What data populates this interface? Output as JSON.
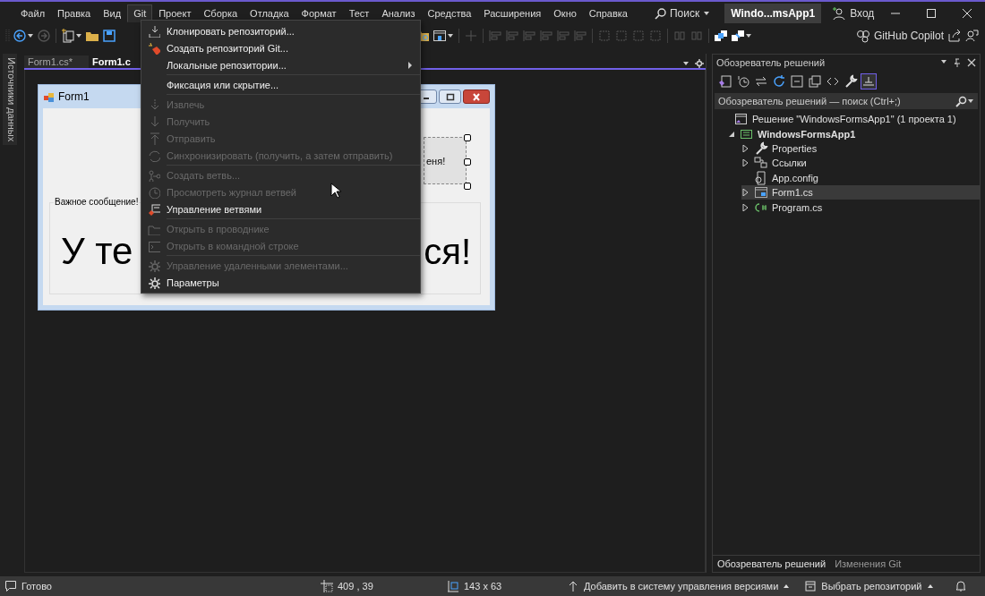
{
  "title_bar": {
    "menu": [
      {
        "label": "Файл",
        "selected": false
      },
      {
        "label": "Правка",
        "selected": false
      },
      {
        "label": "Вид",
        "selected": false
      },
      {
        "label": "Git",
        "selected": true
      },
      {
        "label": "Проект",
        "selected": false
      },
      {
        "label": "Сборка",
        "selected": false
      },
      {
        "label": "Отладка",
        "selected": false
      },
      {
        "label": "Формат",
        "selected": false
      },
      {
        "label": "Тест",
        "selected": false
      },
      {
        "label": "Анализ",
        "selected": false
      },
      {
        "label": "Средства",
        "selected": false
      },
      {
        "label": "Расширения",
        "selected": false
      },
      {
        "label": "Окно",
        "selected": false
      },
      {
        "label": "Справка",
        "selected": false
      }
    ],
    "search": "Поиск",
    "solution_name": "Windo...msApp1",
    "sign_in": "Вход"
  },
  "toolbar": {
    "copilot": "GitHub Copilot"
  },
  "side_strip": {
    "label": "Источники данных"
  },
  "doc_tabs": [
    {
      "label": "Form1.cs*",
      "selected": false
    },
    {
      "label": "Form1.c",
      "selected": true
    }
  ],
  "form": {
    "title": "Form1",
    "button_text": "еня!",
    "group_label": "Важное сообщение!",
    "big_text_left": "У те",
    "big_text_right": "ся!"
  },
  "git_menu": [
    {
      "kind": "item",
      "label": "Клонировать репозиторий...",
      "disabled": false
    },
    {
      "kind": "item",
      "label": "Создать репозиторий Git...",
      "disabled": false
    },
    {
      "kind": "submenu",
      "label": "Локальные репозитории...",
      "disabled": false
    },
    {
      "kind": "separator"
    },
    {
      "kind": "item",
      "label": "Фиксация или скрытие...",
      "disabled": false
    },
    {
      "kind": "separator"
    },
    {
      "kind": "item",
      "label": "Извлечь",
      "disabled": true
    },
    {
      "kind": "item",
      "label": "Получить",
      "disabled": true
    },
    {
      "kind": "item",
      "label": "Отправить",
      "disabled": true
    },
    {
      "kind": "item",
      "label": "Синхронизировать (получить, а затем отправить)",
      "disabled": true
    },
    {
      "kind": "separator"
    },
    {
      "kind": "item",
      "label": "Создать ветвь...",
      "disabled": true
    },
    {
      "kind": "item",
      "label": "Просмотреть журнал ветвей",
      "disabled": true
    },
    {
      "kind": "item",
      "label": "Управление ветвями",
      "disabled": false
    },
    {
      "kind": "separator"
    },
    {
      "kind": "item",
      "label": "Открыть в проводнике",
      "disabled": true
    },
    {
      "kind": "item",
      "label": "Открыть в командной строке",
      "disabled": true
    },
    {
      "kind": "separator"
    },
    {
      "kind": "item",
      "label": "Управление удаленными элементами...",
      "disabled": true
    },
    {
      "kind": "item",
      "label": "Параметры",
      "disabled": false
    }
  ],
  "solution_explorer": {
    "title": "Обозреватель решений",
    "search": {
      "placeholder": "Обозреватель решений — поиск (Ctrl+;)"
    },
    "tree": [
      {
        "label": "Решение \"WindowsFormsApp1\"  (1 проекта 1)",
        "kind": "solution",
        "selected": false,
        "children": [
          {
            "label": "WindowsFormsApp1",
            "kind": "project",
            "expanded": true,
            "selected": false,
            "children": [
              {
                "label": "Properties",
                "kind": "properties",
                "expanded": false,
                "selected": false
              },
              {
                "label": "Ссылки",
                "kind": "references",
                "expanded": false,
                "selected": false
              },
              {
                "label": "App.config",
                "kind": "config",
                "selected": false
              },
              {
                "label": "Form1.cs",
                "kind": "form",
                "expanded": false,
                "selected": true
              },
              {
                "label": "Program.cs",
                "kind": "csharp",
                "expanded": false,
                "selected": false
              }
            ]
          }
        ]
      }
    ],
    "tabs": [
      {
        "label": "Обозреватель решений",
        "selected": true
      },
      {
        "label": "Изменения Git",
        "selected": false
      }
    ]
  },
  "status_bar": {
    "state": "Готово",
    "position": "409 , 39",
    "size": "143 x 63",
    "source_control": "Добавить в систему управления версиями",
    "repository": "Выбрать репозиторий"
  }
}
